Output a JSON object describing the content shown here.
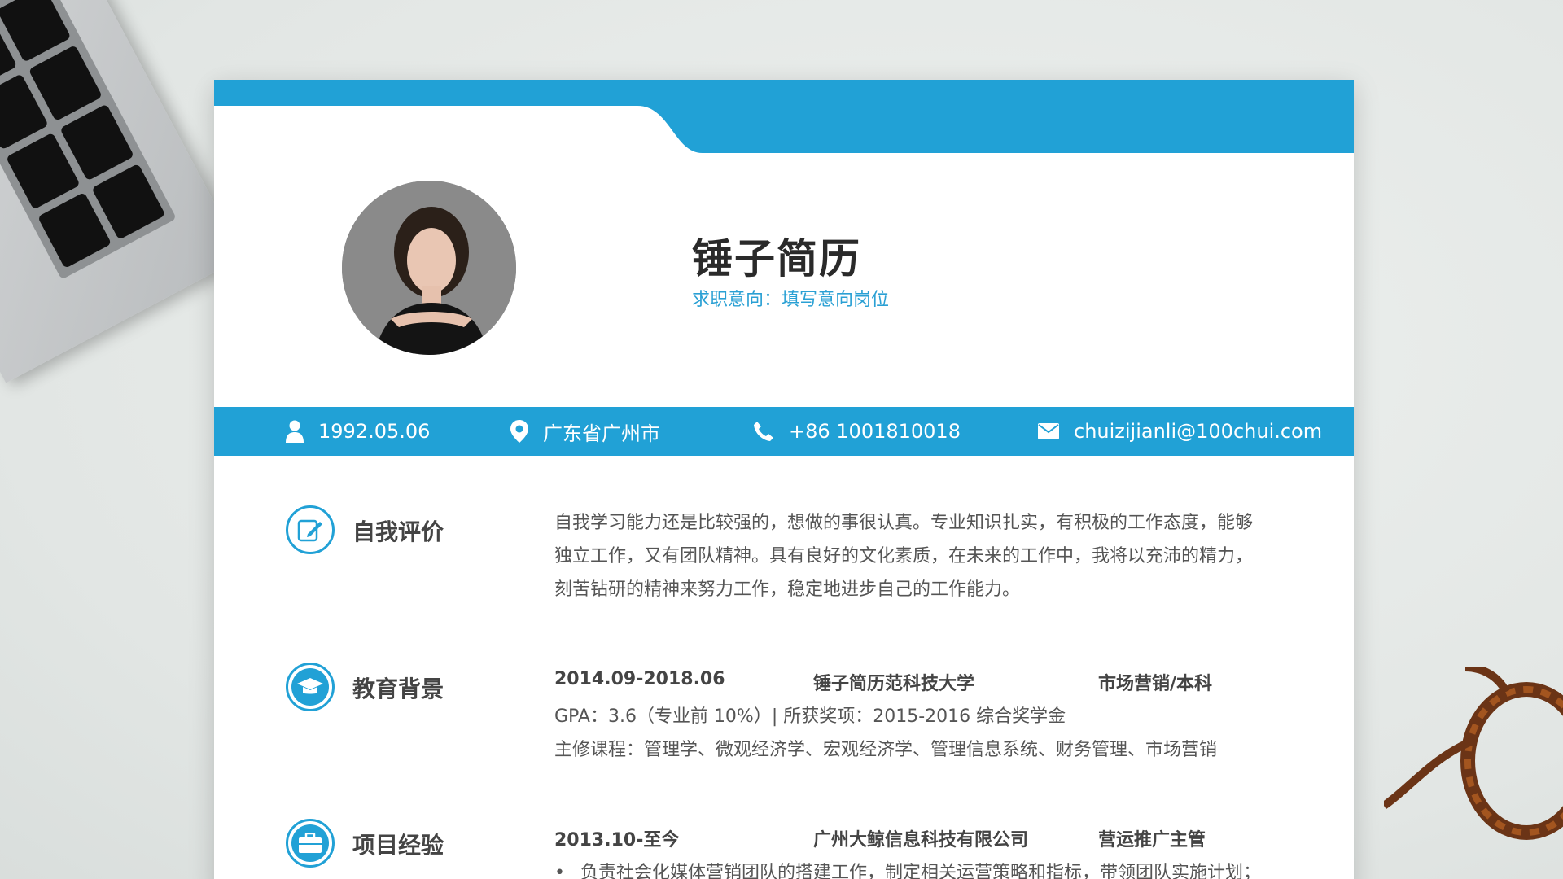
{
  "resume": {
    "name": "锤子简历",
    "intent": "求职意向：填写意向岗位",
    "info": {
      "birth": "1992.05.06",
      "location": "广东省广州市",
      "phone": "+86 1001810018",
      "email": "chuizijianli@100chui.com"
    },
    "sections": {
      "self_eval": {
        "title": "自我评价",
        "lines": [
          "自我学习能力还是比较强的，想做的事很认真。专业知识扎实，有积极的工作态度，能够",
          "独立工作，又有团队精神。具有良好的文化素质，在未来的工作中，我将以充沛的精力，",
          "刻苦钻研的精神来努力工作，稳定地进步自己的工作能力。"
        ]
      },
      "education": {
        "title": "教育背景",
        "period": "2014.09-2018.06",
        "school": "锤子简历范科技大学",
        "major": "市场营销/本科",
        "gpa": "GPA：3.6（专业前 10%）| 所获奖项：2015-2016 综合奖学金",
        "courses": "主修课程：管理学、微观经济学、宏观经济学、管理信息系统、财务管理、市场营销"
      },
      "project": {
        "title": "项目经验",
        "period": "2013.10-至今",
        "company": "广州大鲸信息科技有限公司",
        "role": "营运推广主管",
        "bullet": "负责社会化媒体营销团队的搭建工作，制定相关运营策略和指标，带领团队实施计划；"
      }
    }
  },
  "colors": {
    "accent": "#21a1d6",
    "text": "#555555",
    "heading": "#444444"
  },
  "icons": {
    "birth": "person-icon",
    "location": "location-pin-icon",
    "phone": "phone-icon",
    "email": "envelope-icon",
    "self_eval": "edit-icon",
    "education": "graduation-cap-icon",
    "project": "briefcase-icon"
  }
}
